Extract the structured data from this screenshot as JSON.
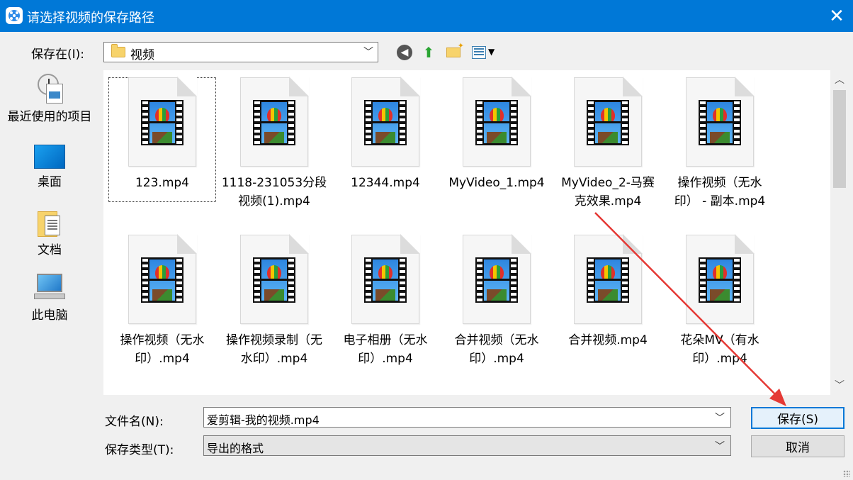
{
  "dialog": {
    "title": "请选择视频的保存路径",
    "close_glyph": "✕"
  },
  "toolbar": {
    "save_in_label": "保存在(I):",
    "location": "视频",
    "icons": [
      "back-icon",
      "up-folder-icon",
      "new-folder-icon",
      "view-menu-icon"
    ]
  },
  "places": [
    {
      "label": "最近使用的项目",
      "icon": "recent-items-icon"
    },
    {
      "label": "桌面",
      "icon": "desktop-icon"
    },
    {
      "label": "文档",
      "icon": "documents-icon"
    },
    {
      "label": "此电脑",
      "icon": "this-pc-icon"
    }
  ],
  "files": [
    {
      "name": "123.mp4",
      "selected": true
    },
    {
      "name": "1118-231053分段\n视频(1).mp4"
    },
    {
      "name": "12344.mp4"
    },
    {
      "name": "MyVideo_1.mp4"
    },
    {
      "name": "MyVideo_2-马赛\n克效果.mp4"
    },
    {
      "name": "操作视频（无水\n印） - 副本.mp4"
    },
    {
      "name": "操作视频（无水\n印）.mp4"
    },
    {
      "name": "操作视频录制（无\n水印）.mp4"
    },
    {
      "name": "电子相册（无水\n印）.mp4"
    },
    {
      "name": "合并视频（无水\n印）.mp4"
    },
    {
      "name": "合并视频.mp4"
    },
    {
      "name": "花朵MV（有水\n印）.mp4"
    }
  ],
  "form": {
    "filename_label": "文件名(N):",
    "filename_value": "爱剪辑-我的视频.mp4",
    "filetype_label": "保存类型(T):",
    "filetype_value": "导出的格式",
    "save_button": "保存(S)",
    "cancel_button": "取消"
  },
  "colors": {
    "titlebar": "#0078d7",
    "annotation_arrow": "#e53935"
  }
}
